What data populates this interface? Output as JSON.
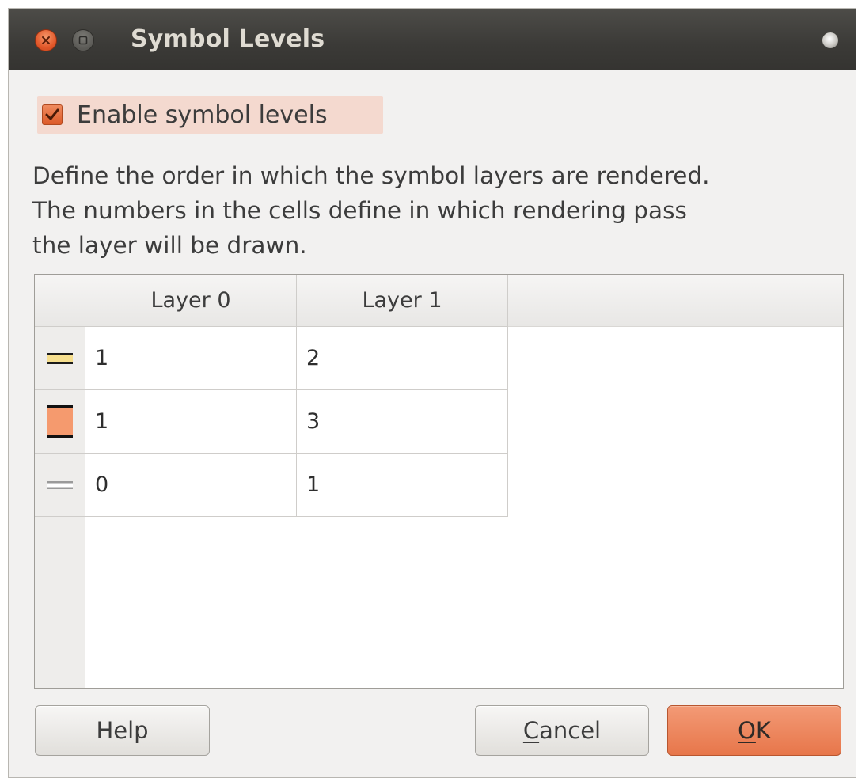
{
  "window": {
    "title": "Symbol Levels",
    "close_icon": "close-icon",
    "maximize_icon": "maximize-icon",
    "menu_icon": "window-menu-icon"
  },
  "enable_checkbox": {
    "label": "Enable symbol levels",
    "checked": true
  },
  "description": {
    "line1": "Define the order in which the symbol layers are rendered.",
    "line2": "The numbers in the cells define in which rendering pass",
    "line3": "the layer will be drawn."
  },
  "table": {
    "columns": [
      "Layer 0",
      "Layer 1"
    ],
    "rows": [
      {
        "symbol": "line-symbol-tan",
        "values": [
          "1",
          "2"
        ]
      },
      {
        "symbol": "fill-symbol-orange",
        "values": [
          "1",
          "3"
        ]
      },
      {
        "symbol": "line-symbol-gray",
        "values": [
          "0",
          "1"
        ]
      }
    ]
  },
  "buttons": {
    "help": "Help",
    "cancel_first": "C",
    "cancel_rest": "ancel",
    "ok_first": "O",
    "ok_rest": "K"
  },
  "colors": {
    "accent": "#e2602f",
    "titlebar": "#3c3b37",
    "dialog_bg": "#f2f1f0"
  }
}
